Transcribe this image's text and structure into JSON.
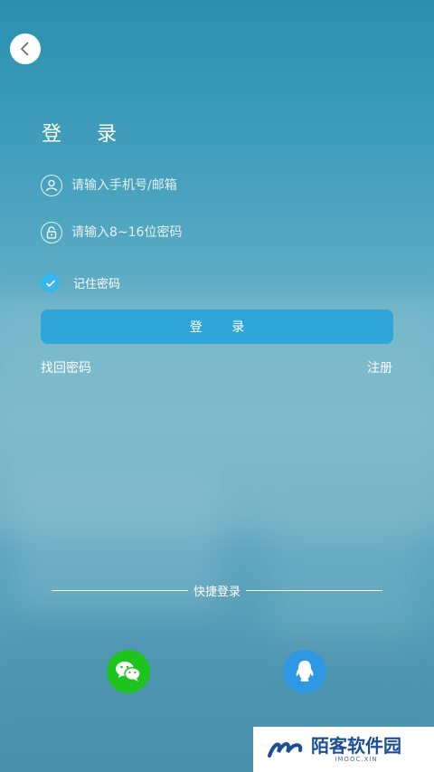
{
  "header": {
    "back_icon": "chevron-left-icon"
  },
  "login": {
    "title": "登  录",
    "phone_field": {
      "icon": "user-icon",
      "placeholder": "请输入手机号/邮箱",
      "value": ""
    },
    "password_field": {
      "icon": "lock-icon",
      "placeholder": "请输入8~16位密码",
      "value": ""
    },
    "remember": {
      "label": "记住密码",
      "checked": true
    },
    "submit_label": "登  录",
    "forgot_label": "找回密码",
    "register_label": "注册"
  },
  "quick_login": {
    "label": "快捷登录",
    "providers": [
      {
        "name": "wechat",
        "icon": "wechat-icon",
        "color": "#1ec31e"
      },
      {
        "name": "qq",
        "icon": "qq-icon",
        "color": "#2f98e3"
      }
    ]
  },
  "watermark": {
    "title": "陌客软件园",
    "subtitle": "IMOOC.XIN"
  },
  "colors": {
    "accent": "#2fa6d7",
    "checkbox": "#36b6ec"
  }
}
